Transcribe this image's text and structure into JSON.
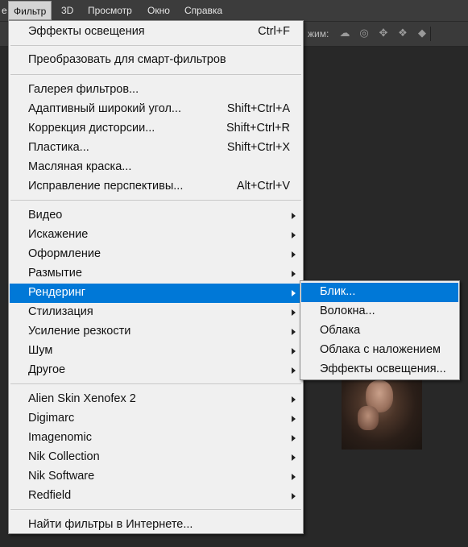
{
  "menubar": {
    "cut_item": "е",
    "filter": "Фильтр",
    "3d": "3D",
    "view": "Просмотр",
    "window": "Окно",
    "help": "Справка"
  },
  "options": {
    "mode_label": "жим:",
    "icons": [
      "orbit-icon",
      "roll-icon",
      "pan-icon",
      "slide-icon",
      "scale-icon"
    ]
  },
  "filter_menu": {
    "last_filter": {
      "label": "Эффекты освещения",
      "shortcut": "Ctrl+F"
    },
    "smart": {
      "label": "Преобразовать для смарт-фильтров"
    },
    "gallery": {
      "label": "Галерея фильтров..."
    },
    "adaptive": {
      "label": "Адаптивный широкий угол...",
      "shortcut": "Shift+Ctrl+A"
    },
    "lens": {
      "label": "Коррекция дисторсии...",
      "shortcut": "Shift+Ctrl+R"
    },
    "liquify": {
      "label": "Пластика...",
      "shortcut": "Shift+Ctrl+X"
    },
    "oil": {
      "label": "Масляная краска..."
    },
    "vanishing": {
      "label": "Исправление перспективы...",
      "shortcut": "Alt+Ctrl+V"
    },
    "video": {
      "label": "Видео"
    },
    "distort": {
      "label": "Искажение"
    },
    "pixelate": {
      "label": "Оформление"
    },
    "blur": {
      "label": "Размытие"
    },
    "render": {
      "label": "Рендеринг"
    },
    "stylize": {
      "label": "Стилизация"
    },
    "sharpen": {
      "label": "Усиление резкости"
    },
    "noise": {
      "label": "Шум"
    },
    "other": {
      "label": "Другое"
    },
    "alien": {
      "label": "Alien Skin Xenofex 2"
    },
    "digimarc": {
      "label": "Digimarc"
    },
    "imagenomic": {
      "label": "Imagenomic"
    },
    "nik_collection": {
      "label": "Nik Collection"
    },
    "nik_software": {
      "label": "Nik Software"
    },
    "redfield": {
      "label": "Redfield"
    },
    "browse": {
      "label": "Найти фильтры в Интернете..."
    }
  },
  "render_submenu": {
    "flare": {
      "label": "Блик..."
    },
    "fibers": {
      "label": "Волокна..."
    },
    "clouds": {
      "label": "Облака"
    },
    "diff_clouds": {
      "label": "Облака с наложением"
    },
    "lighting": {
      "label": "Эффекты освещения..."
    }
  },
  "colors": {
    "highlight": "#0078d7",
    "menu_bg": "#f0f0f0",
    "chrome_bg": "#3c3c3c",
    "workspace_bg": "#282828"
  }
}
